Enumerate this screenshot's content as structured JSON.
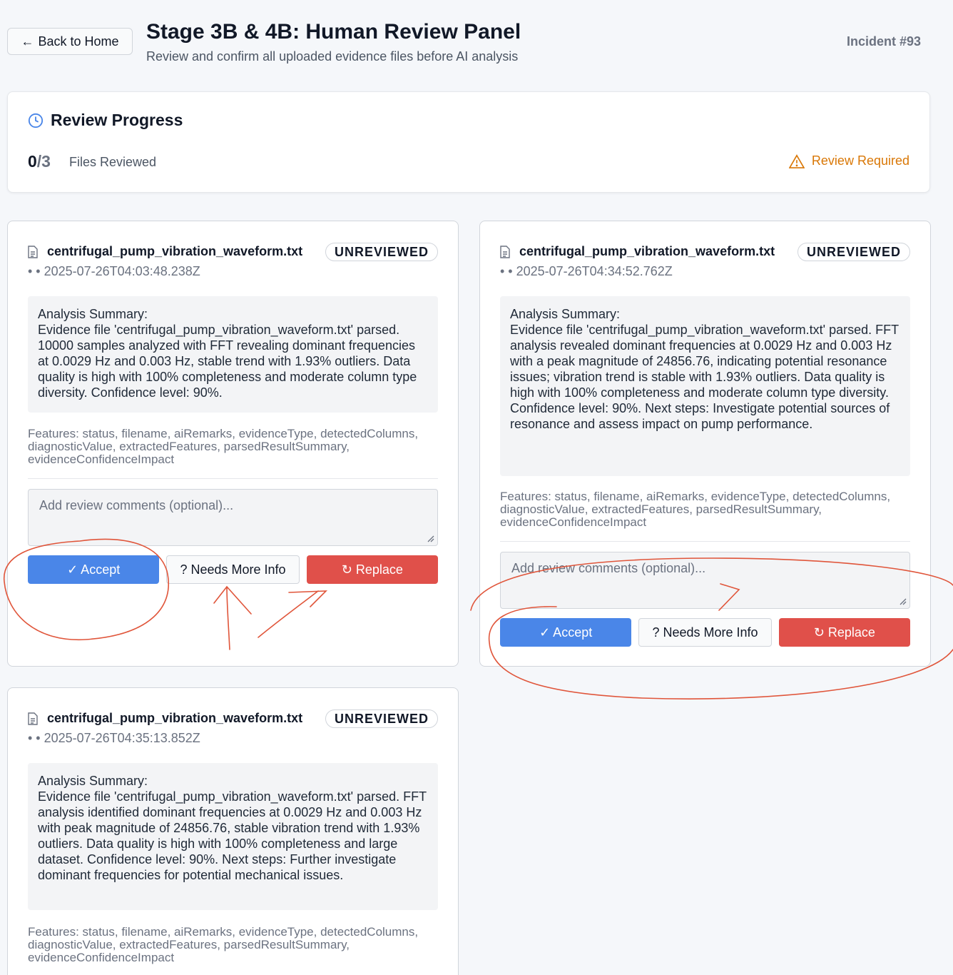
{
  "header": {
    "back_label": "Back to Home",
    "title": "Stage 3B & 4B: Human Review Panel",
    "subtitle": "Review and confirm all uploaded evidence files before AI analysis",
    "incident": "Incident #93"
  },
  "progress": {
    "title": "Review Progress",
    "reviewed": "0",
    "total": "/3",
    "label": "Files Reviewed",
    "status": "Review Required"
  },
  "comment_placeholder": "Add review comments (optional)...",
  "buttons": {
    "accept": "✓ Accept",
    "info": "? Needs More Info",
    "replace": "↻ Replace"
  },
  "cards": [
    {
      "filename": "centrifugal_pump_vibration_waveform.txt",
      "status": "UNREVIEWED",
      "timestamp": "• • 2025-07-26T04:03:48.238Z",
      "summary_label": "Analysis Summary:",
      "summary": "Evidence file 'centrifugal_pump_vibration_waveform.txt' parsed. 10000 samples analyzed with FFT revealing dominant frequencies at 0.0029 Hz and 0.003 Hz, stable trend with 1.93% outliers. Data quality is high with 100% completeness and moderate column type diversity. Confidence level: 90%.",
      "features": "Features: status, filename, aiRemarks, evidenceType, detectedColumns, diagnosticValue, extractedFeatures, parsedResultSummary, evidenceConfidenceImpact"
    },
    {
      "filename": "centrifugal_pump_vibration_waveform.txt",
      "status": "UNREVIEWED",
      "timestamp": "• • 2025-07-26T04:34:52.762Z",
      "summary_label": "Analysis Summary:",
      "summary": "Evidence file 'centrifugal_pump_vibration_waveform.txt' parsed. FFT analysis revealed dominant frequencies at 0.0029 Hz and 0.003 Hz with a peak magnitude of 24856.76, indicating potential resonance issues; vibration trend is stable with 1.93% outliers. Data quality is high with 100% completeness and moderate column type diversity. Confidence level: 90%. Next steps: Investigate potential sources of resonance and assess impact on pump performance.",
      "features": "Features: status, filename, aiRemarks, evidenceType, detectedColumns, diagnosticValue, extractedFeatures, parsedResultSummary, evidenceConfidenceImpact"
    },
    {
      "filename": "centrifugal_pump_vibration_waveform.txt",
      "status": "UNREVIEWED",
      "timestamp": "• • 2025-07-26T04:35:13.852Z",
      "summary_label": "Analysis Summary:",
      "summary": "Evidence file 'centrifugal_pump_vibration_waveform.txt' parsed. FFT analysis identified dominant frequencies at 0.0029 Hz and 0.003 Hz with peak magnitude of 24856.76, stable vibration trend with 1.93% outliers. Data quality is high with 100% completeness and large dataset. Confidence level: 90%. Next steps: Further investigate dominant frequencies for potential mechanical issues.",
      "features": "Features: status, filename, aiRemarks, evidenceType, detectedColumns, diagnosticValue, extractedFeatures, parsedResultSummary, evidenceConfidenceImpact"
    }
  ],
  "colors": {
    "accent": "#4a86e8",
    "danger": "#e0504a",
    "warning": "#d97706",
    "annotation": "#e0553a"
  }
}
